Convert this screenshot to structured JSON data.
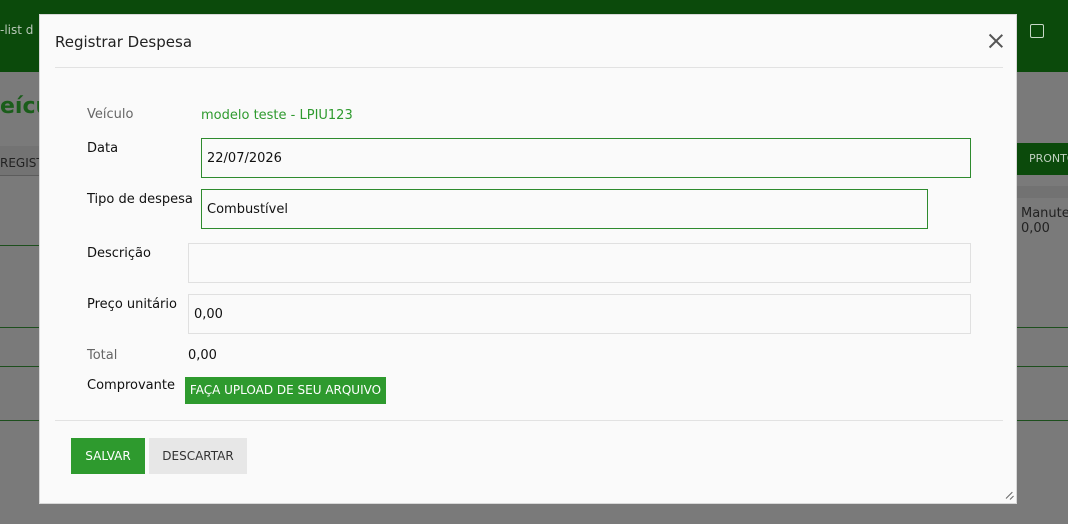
{
  "background": {
    "header_text": "-list d",
    "page_title": "eícul",
    "left_tab": "REGIST",
    "right_tab": "PRONTO",
    "maint_label": "Manuten",
    "maint_value": "0,00"
  },
  "modal": {
    "title": "Registrar Despesa",
    "fields": {
      "vehicle": {
        "label": "Veículo",
        "value": "modelo teste - LPIU123"
      },
      "date": {
        "label": "Data",
        "value": "22/07/2026"
      },
      "expense_type": {
        "label": "Tipo de despesa",
        "value": "Combustível"
      },
      "description": {
        "label": "Descrição",
        "value": ""
      },
      "unit_price": {
        "label": "Preço unitário",
        "value": "0,00"
      },
      "total": {
        "label": "Total",
        "value": "0,00"
      },
      "receipt": {
        "label": "Comprovante",
        "button": "FAÇA UPLOAD DE SEU ARQUIVO"
      }
    },
    "actions": {
      "save": "SALVAR",
      "discard": "DESCARTAR"
    }
  },
  "colors": {
    "primary": "#2e9a2e",
    "header": "#0b4a0b"
  }
}
